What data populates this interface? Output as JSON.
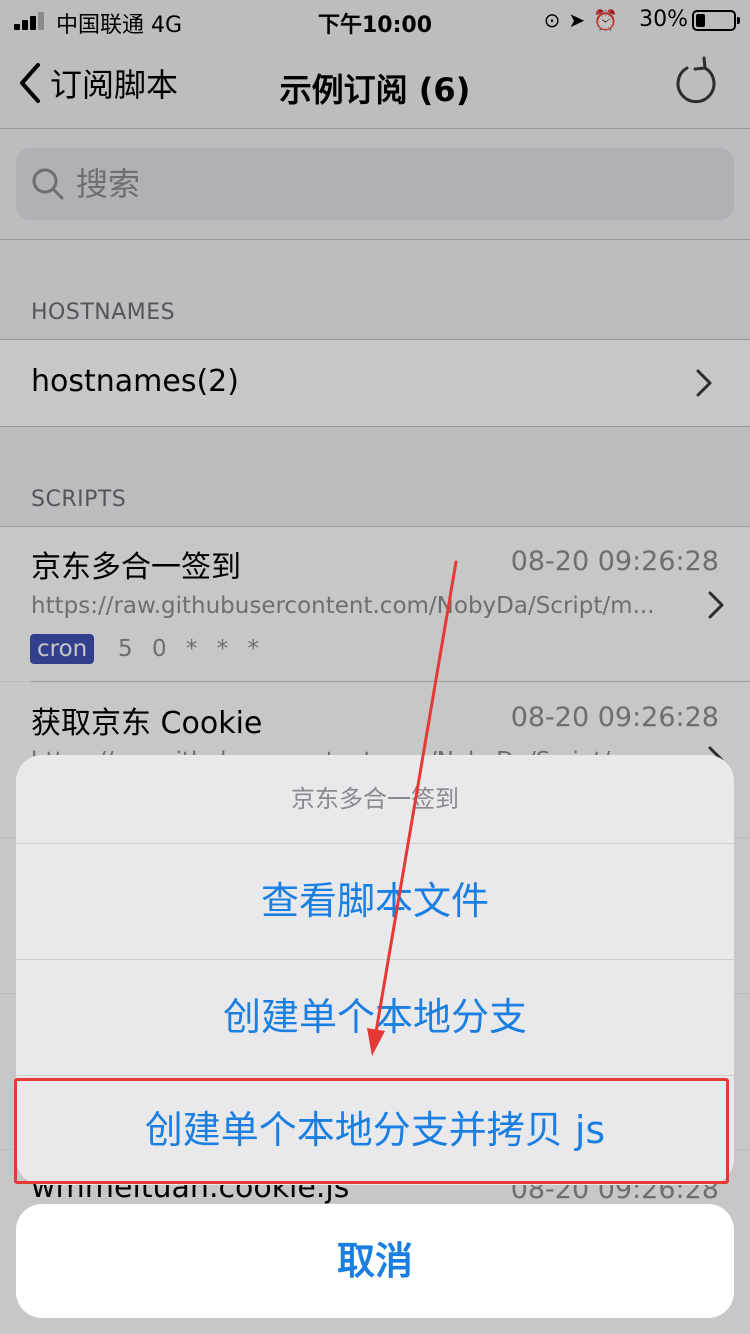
{
  "status_bar": {
    "carrier": "中国联通  4G",
    "time": "下午10:00",
    "battery_pct": "30%"
  },
  "nav": {
    "back_label": "订阅脚本",
    "title": "示例订阅 (6)"
  },
  "search": {
    "placeholder": "搜索"
  },
  "hostnames_section": {
    "header": "HOSTNAMES",
    "item_label": "hostnames(2)"
  },
  "scripts_section": {
    "header": "SCRIPTS",
    "items": [
      {
        "title": "京东多合一签到",
        "time": "08-20 09:26:28",
        "url": "https://raw.githubusercontent.com/NobyDa/Script/m...",
        "tag": "cron",
        "cron": "5 0 * * *"
      },
      {
        "title": "获取京东 Cookie",
        "time": "08-20 09:26:28",
        "url": "https://raw.githubusercontent.com/NobyDa/Script/m..."
      },
      {
        "title": "wmmeituan.cookie.js",
        "time": "08-20 09:26:28"
      }
    ]
  },
  "action_sheet": {
    "title": "京东多合一签到",
    "actions": [
      "查看脚本文件",
      "创建单个本地分支",
      "创建单个本地分支并拷贝 js"
    ],
    "cancel": "取消"
  },
  "colors": {
    "accent_blue": "#1a7fe0",
    "cron_tag": "#3f51b5",
    "annotation_red": "#e53935"
  }
}
